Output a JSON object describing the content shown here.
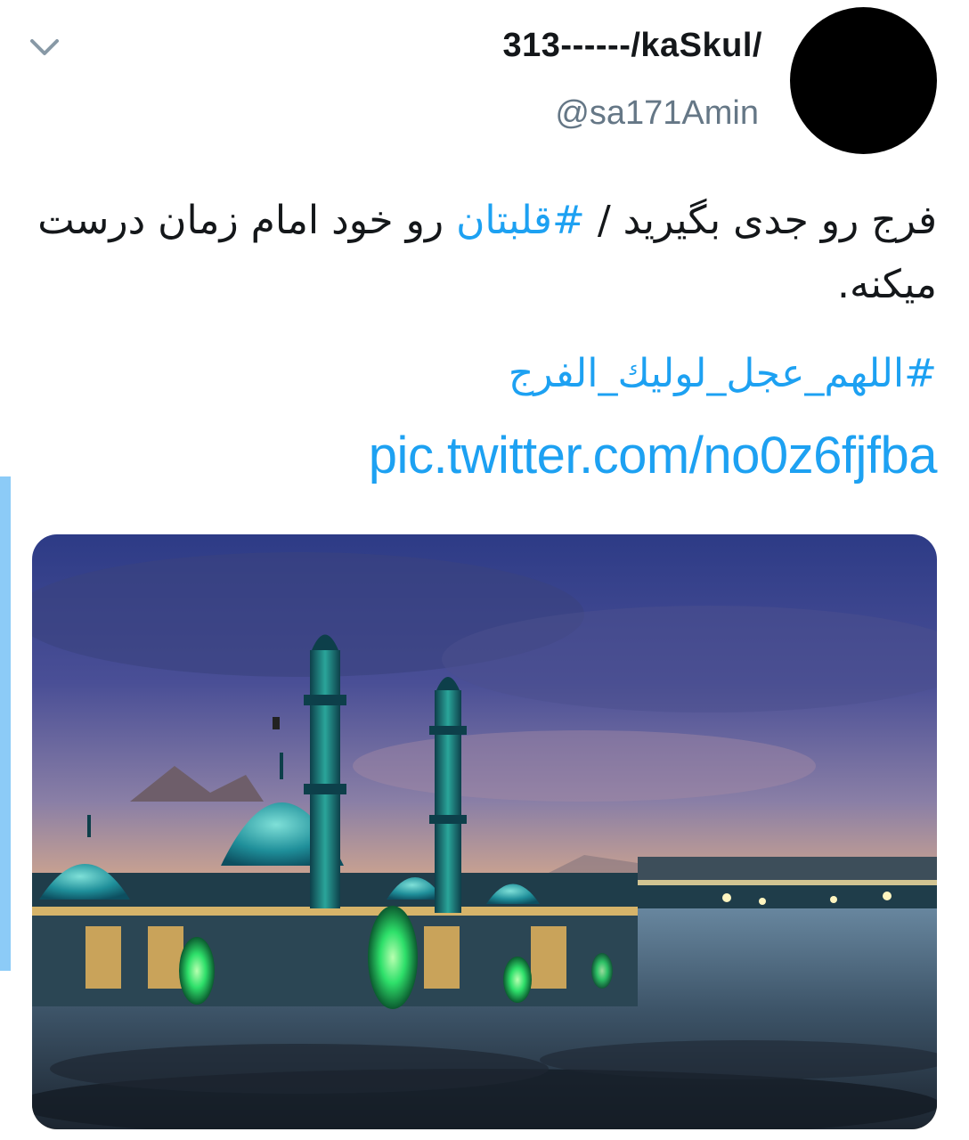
{
  "tweet": {
    "display_name": "313------/kaSkul/",
    "handle": "@sa171Amin",
    "text_part1": "فرج رو جدی بگیرید /",
    "hashtag1": "#قلبتان",
    "text_part2": " رو خود امام زمان درست میکنه.",
    "hashtag2": "#اللهم_عجل_لوليك_الفرج",
    "pic_link": "pic.twitter.com/no0z6fjfba"
  },
  "icons": {
    "chevron": "chevron-down-icon",
    "avatar": "avatar"
  },
  "colors": {
    "link": "#1da1f2",
    "text": "#14171a",
    "secondary": "#657786",
    "quote_bar": "#8ccbf7"
  }
}
